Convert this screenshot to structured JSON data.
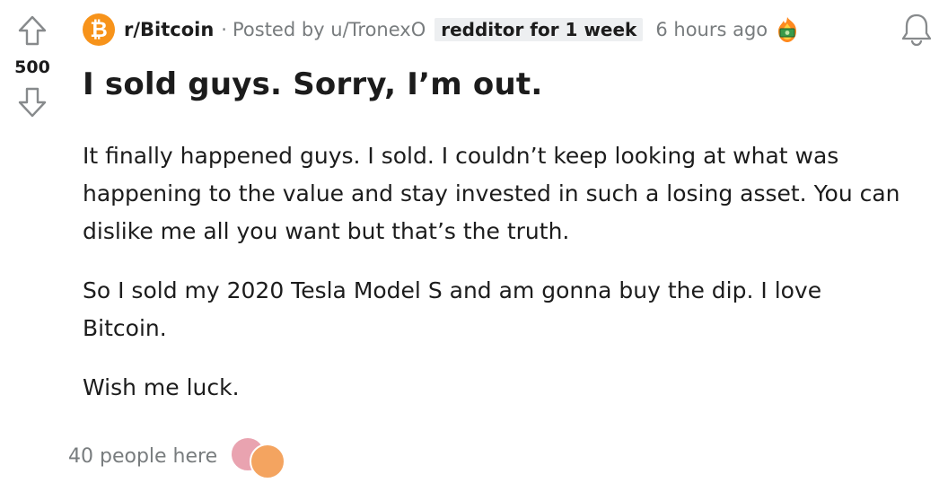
{
  "vote": {
    "score": "500"
  },
  "meta": {
    "subreddit": "r/Bitcoin",
    "separator": "·",
    "posted_by": "Posted by u/TronexO",
    "flair": "redditor for 1 week",
    "time": "6 hours ago",
    "subreddit_icon": "bitcoin-icon",
    "award_icon": "money-award-icon"
  },
  "post": {
    "title": "I sold guys. Sorry, I’m out.",
    "paragraphs": [
      "It finally happened guys. I sold. I couldn’t keep looking at what was happening to the value and stay invested in such a losing asset. You can dislike me all you want but that’s the truth.",
      "So I sold my 2020 Tesla Model S and am gonna buy the dip. I love Bitcoin.",
      "Wish me luck."
    ]
  },
  "footer": {
    "presence": "40 people here"
  },
  "colors": {
    "bitcoin_orange": "#f7931a",
    "meta_gray": "#787c7e",
    "flair_bg": "#edeff1"
  }
}
